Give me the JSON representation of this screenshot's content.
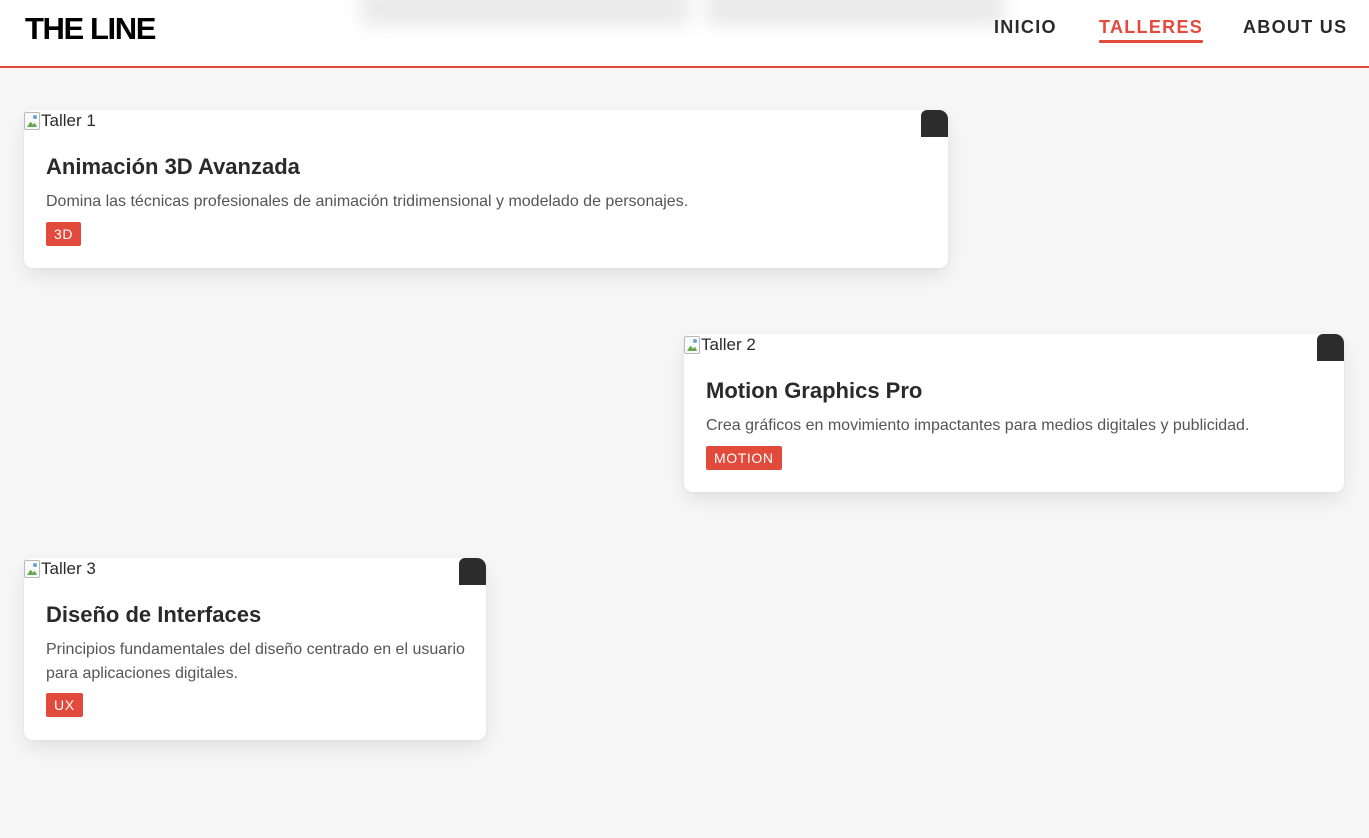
{
  "header": {
    "logo": "THE LINE",
    "nav": [
      {
        "label": "INICIO",
        "active": false
      },
      {
        "label": "TALLERES",
        "active": true
      },
      {
        "label": "ABOUT US",
        "active": false
      }
    ]
  },
  "cards": [
    {
      "image_alt": "Taller 1",
      "title": "Animación 3D Avanzada",
      "description": "Domina las técnicas profesionales de animación tridimensional y modelado de personajes.",
      "tag": "3D"
    },
    {
      "image_alt": "Taller 2",
      "title": "Motion Graphics Pro",
      "description": "Crea gráficos en movimiento impactantes para medios digitales y publicidad.",
      "tag": "MOTION"
    },
    {
      "image_alt": "Taller 3",
      "title": "Diseño de Interfaces",
      "description": "Principios fundamentales del diseño centrado en el usuario para aplicaciones digitales.",
      "tag": "UX"
    }
  ],
  "colors": {
    "accent": "#e24a3b",
    "background": "#f7f7f7",
    "card": "#ffffff",
    "text": "#2a2a2a",
    "corner": "#2c2c2c"
  }
}
